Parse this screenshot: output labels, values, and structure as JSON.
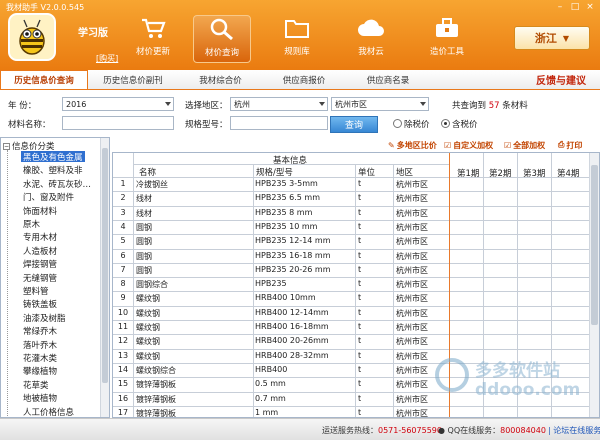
{
  "window": {
    "app_title": "我材助手 V2.0.0.545",
    "controls": [
      "–",
      "□",
      "×"
    ]
  },
  "header": {
    "edition": "学习版",
    "edition_link": "[购买]",
    "nav": [
      {
        "label": "材价更新",
        "icon": "cart-icon"
      },
      {
        "label": "材价查询",
        "icon": "search-icon",
        "active": true
      },
      {
        "label": "规则库",
        "icon": "folder-icon"
      },
      {
        "label": "我材云",
        "icon": "cloud-icon"
      },
      {
        "label": "造价工具",
        "icon": "toolbox-icon"
      }
    ],
    "region": "浙江"
  },
  "tabs": [
    {
      "label": "历史信息价查询",
      "active": true
    },
    {
      "label": "历史信息价副刊"
    },
    {
      "label": "我材综合价"
    },
    {
      "label": "供应商报价"
    },
    {
      "label": "供应商名录"
    }
  ],
  "feedback": "反馈与建议",
  "filters": {
    "year_label": "年    份：",
    "year_value": "2016",
    "region_label": "选择地区：",
    "region_value": "杭州",
    "area_value": "杭州市区",
    "result_prefix": "共查询到",
    "result_count": "57",
    "result_suffix": "条材料",
    "material_label": "材料名称：",
    "spec_label": "规格型号：",
    "query_button": "查询",
    "tax_options": [
      "除税价",
      "含税价"
    ]
  },
  "toolbar": {
    "multi_region": "多地区比价",
    "custom_add": "自定义加权",
    "all_add": "全部加权",
    "print": "打印"
  },
  "sidebar": {
    "root": "信息价分类",
    "items": [
      "黑色及有色金属",
      "橡胶、塑料及非",
      "水泥、砖瓦灰砂…",
      "门、窗及附件",
      "饰面材料",
      "原木",
      "专用木材",
      "人造板材",
      "焊接钢管",
      "无缝钢管",
      "塑料管",
      "铸铁盖板",
      "油漆及树脂",
      "常绿乔木",
      "落叶乔木",
      "花灌木类",
      "攀缘植物",
      "花草类",
      "地被植物",
      "人工价格信息"
    ],
    "selected": 0
  },
  "grid": {
    "group_header": "基本信息",
    "columns": [
      "名称",
      "规格/型号",
      "单位",
      "地区"
    ],
    "period_columns": [
      "第1期",
      "第2期",
      "第3期",
      "第4期"
    ],
    "rows": [
      [
        "1",
        "冷拔钢丝",
        "HPB235 3-5mm",
        "t",
        "杭州市区"
      ],
      [
        "2",
        "线材",
        "HPB235 6.5 mm",
        "t",
        "杭州市区"
      ],
      [
        "3",
        "线材",
        "HPB235 8 mm",
        "t",
        "杭州市区"
      ],
      [
        "4",
        "圆钢",
        "HPB235 10 mm",
        "t",
        "杭州市区"
      ],
      [
        "5",
        "圆钢",
        "HPB235 12-14 mm",
        "t",
        "杭州市区"
      ],
      [
        "6",
        "圆钢",
        "HPB235 16-18 mm",
        "t",
        "杭州市区"
      ],
      [
        "7",
        "圆钢",
        "HPB235 20-26 mm",
        "t",
        "杭州市区"
      ],
      [
        "8",
        "圆钢综合",
        "HPB235",
        "t",
        "杭州市区"
      ],
      [
        "9",
        "螺纹钢",
        "HRB400 10mm",
        "t",
        "杭州市区"
      ],
      [
        "10",
        "螺纹钢",
        "HRB400 12-14mm",
        "t",
        "杭州市区"
      ],
      [
        "11",
        "螺纹钢",
        "HRB400 16-18mm",
        "t",
        "杭州市区"
      ],
      [
        "12",
        "螺纹钢",
        "HRB400 20-26mm",
        "t",
        "杭州市区"
      ],
      [
        "13",
        "螺纹钢",
        "HRB400 28-32mm",
        "t",
        "杭州市区"
      ],
      [
        "14",
        "螺纹钢综合",
        "HRB400",
        "t",
        "杭州市区"
      ],
      [
        "15",
        "镀锌薄钢板",
        "0.5 mm",
        "t",
        "杭州市区"
      ],
      [
        "16",
        "镀锌薄钢板",
        "0.7 mm",
        "t",
        "杭州市区"
      ],
      [
        "17",
        "镀锌薄钢板",
        "1 mm",
        "t",
        "杭州市区"
      ]
    ]
  },
  "watermark": {
    "line1": "多多软件站",
    "line2": "ddooo.com"
  },
  "status": {
    "hotline_label": "运送服务热线：",
    "hotline": "0571-56075590",
    "qq_label": "QQ在线服务：",
    "qq": "800084040",
    "forum": "论坛在线服务"
  }
}
